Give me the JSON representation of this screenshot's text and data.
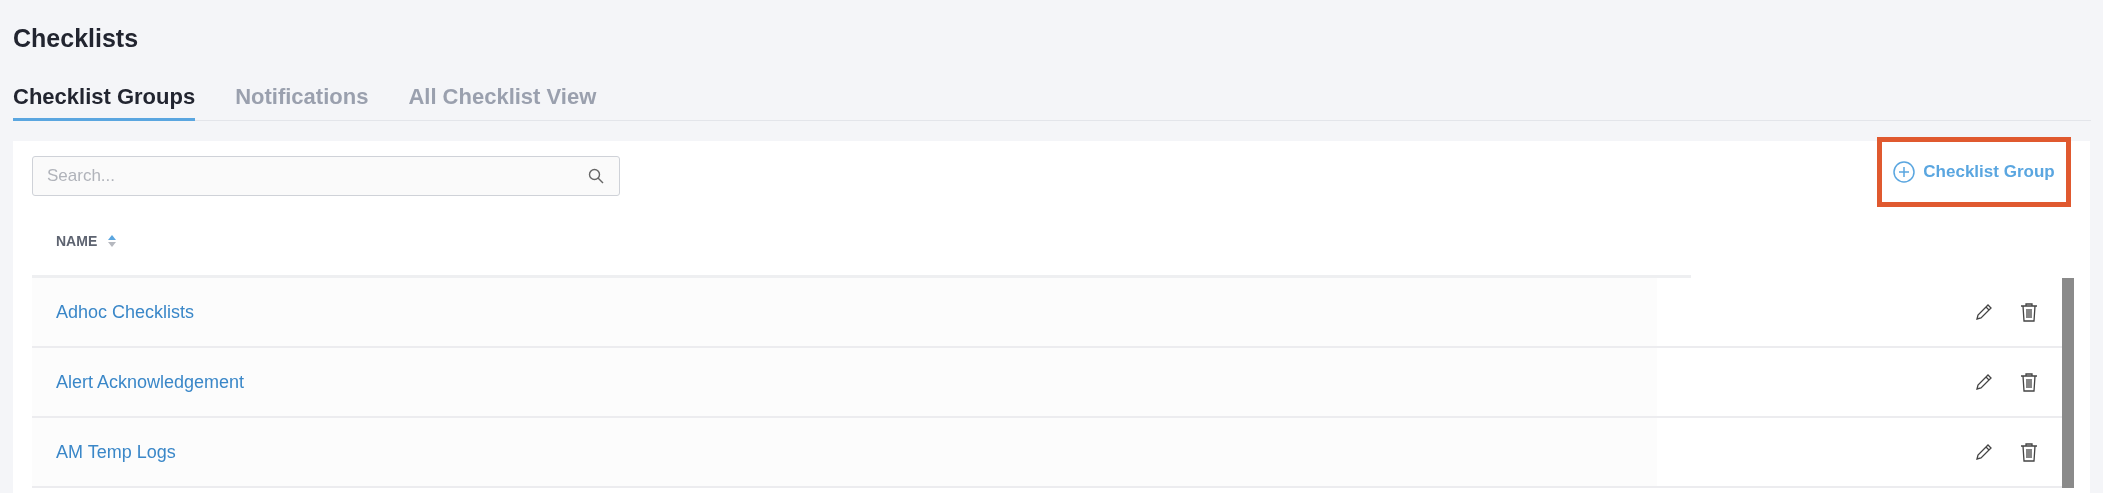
{
  "page": {
    "title": "Checklists"
  },
  "tabs": [
    {
      "label": "Checklist Groups",
      "selected": true
    },
    {
      "label": "Notifications",
      "selected": false
    },
    {
      "label": "All Checklist View",
      "selected": false
    }
  ],
  "search": {
    "placeholder": "Search..."
  },
  "add_button": {
    "label": "Checklist Group",
    "highlighted": true
  },
  "table": {
    "columns": [
      {
        "label": "NAME",
        "sort_ascending": true
      }
    ],
    "rows": [
      {
        "name": "Adhoc Checklists"
      },
      {
        "name": "Alert Acknowledgement"
      },
      {
        "name": "AM Temp Logs"
      }
    ]
  }
}
